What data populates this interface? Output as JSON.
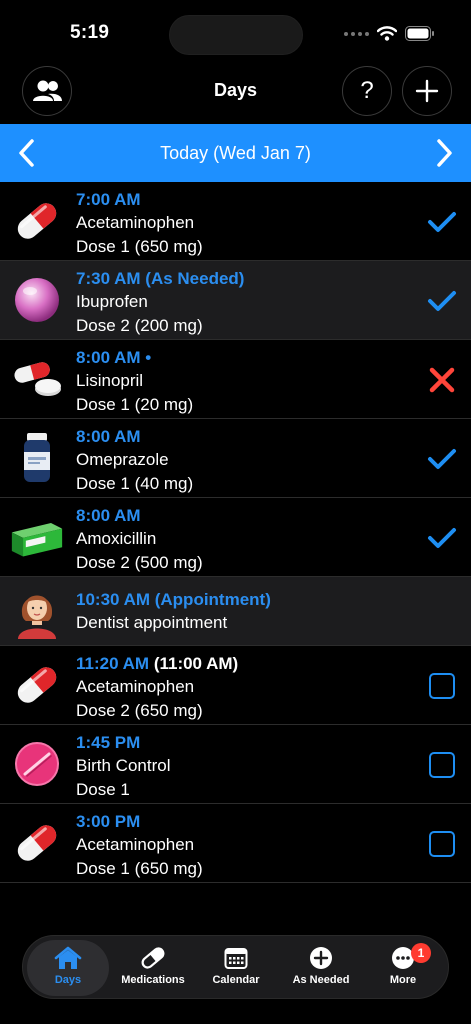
{
  "status_bar": {
    "time": "5:19"
  },
  "nav": {
    "title": "Days",
    "help_label": "?"
  },
  "day": {
    "title": "Today (Wed Jan 7)"
  },
  "entries": [
    {
      "time": "7:00 AM",
      "extra": "",
      "name": "Acetaminophen",
      "dose": "Dose 1 (650 mg)",
      "icon": "pill-capsule-icon",
      "status": "taken"
    },
    {
      "time": "7:30 AM (As Needed)",
      "extra": "",
      "name": "Ibuprofen",
      "dose": "Dose 2 (200 mg)",
      "icon": "pink-pearl-pill-icon",
      "status": "taken"
    },
    {
      "time": "8:00 AM •",
      "extra": "",
      "name": "Lisinopril",
      "dose": "Dose 1 (20 mg)",
      "icon": "pills-icon",
      "status": "missed"
    },
    {
      "time": "8:00 AM",
      "extra": "",
      "name": "Omeprazole",
      "dose": "Dose 1 (40 mg)",
      "icon": "pill-bottle-icon",
      "status": "taken"
    },
    {
      "time": "8:00 AM",
      "extra": "",
      "name": "Amoxicillin",
      "dose": "Dose 2 (500 mg)",
      "icon": "medicine-box-icon",
      "status": "taken"
    },
    {
      "time": "10:30 AM (Appointment)",
      "extra": "",
      "name": "Dentist appointment",
      "dose": "",
      "icon": "person-avatar-icon",
      "status": "none"
    },
    {
      "time": "11:20 AM",
      "extra": "(11:00 AM)",
      "name": "Acetaminophen",
      "dose": "Dose 2 (650 mg)",
      "icon": "pill-capsule-icon",
      "status": "pending"
    },
    {
      "time": "1:45 PM",
      "extra": "",
      "name": "Birth Control",
      "dose": "Dose 1",
      "icon": "pink-tablet-icon",
      "status": "pending"
    },
    {
      "time": "3:00 PM",
      "extra": "",
      "name": "Acetaminophen",
      "dose": "Dose 1 (650 mg)",
      "icon": "pill-capsule-icon",
      "status": "pending"
    }
  ],
  "tabs": [
    {
      "label": "Days",
      "icon": "house-icon",
      "active": true
    },
    {
      "label": "Medications",
      "icon": "pill-icon",
      "active": false
    },
    {
      "label": "Calendar",
      "icon": "calendar-icon",
      "active": false
    },
    {
      "label": "As Needed",
      "icon": "plus-circle-icon",
      "active": false
    },
    {
      "label": "More",
      "icon": "more-icon",
      "active": false,
      "badge": "1"
    }
  ],
  "colors": {
    "accent": "#1e90ff",
    "taken": "#1e8ef2",
    "missed": "#ff453a"
  }
}
